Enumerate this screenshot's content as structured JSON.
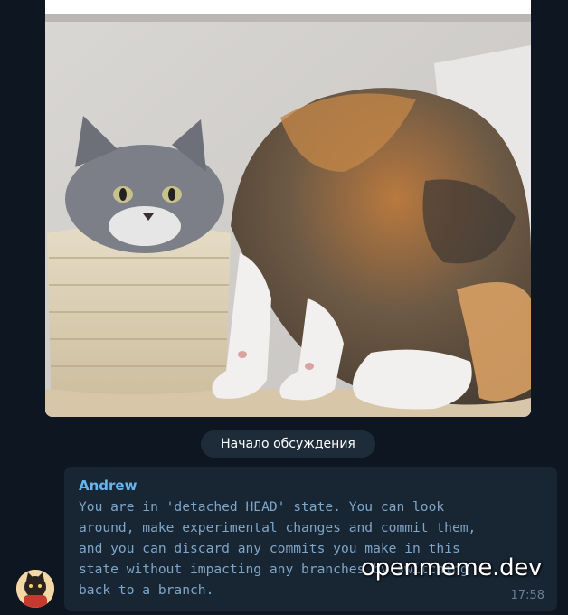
{
  "photo": {
    "icon": "cats-photo"
  },
  "discussion": {
    "label": "Начало обсуждения"
  },
  "message": {
    "sender": "Andrew",
    "text": "You are in 'detached HEAD' state. You can look\naround, make experimental changes and commit them,\nand you can discard any commits you make in this\nstate without impacting any branches by switching\nback to a branch.",
    "time": "17:58"
  },
  "watermark": {
    "text": "openmeme.dev"
  },
  "colors": {
    "background": "#0e1621",
    "bubble": "#182533",
    "sender": "#64b5ef",
    "message_text": "#7ea6c9",
    "pill": "#1e2c3a"
  }
}
